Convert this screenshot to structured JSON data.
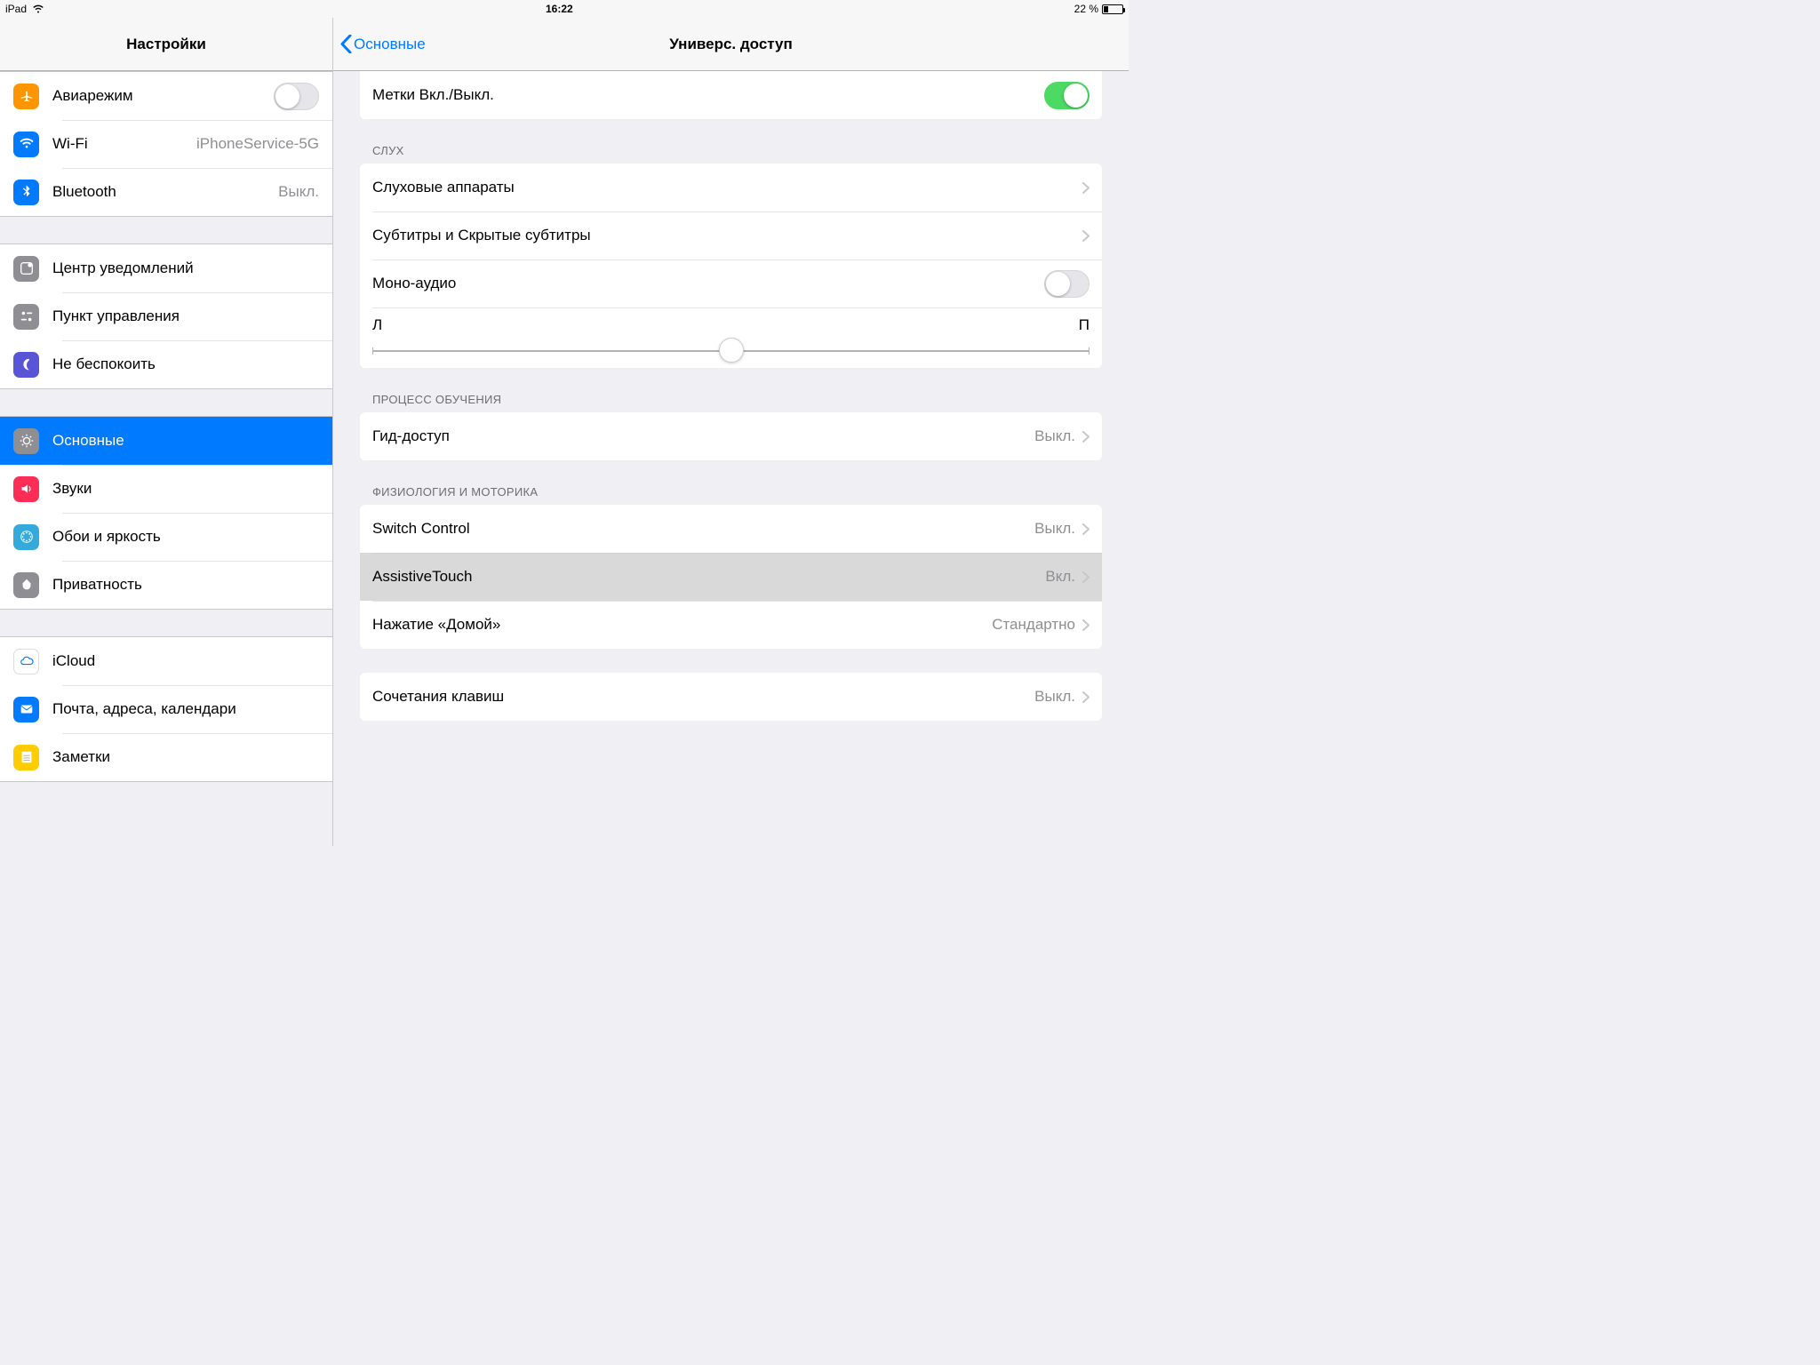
{
  "statusbar": {
    "device": "iPad",
    "time": "16:22",
    "battery_pct": "22 %"
  },
  "sidebar": {
    "title": "Настройки",
    "groups": [
      [
        {
          "id": "airplane",
          "label": "Авиарежим",
          "toggle": false
        },
        {
          "id": "wifi",
          "label": "Wi-Fi",
          "value": "iPhoneService-5G"
        },
        {
          "id": "bluetooth",
          "label": "Bluetooth",
          "value": "Выкл."
        }
      ],
      [
        {
          "id": "notif",
          "label": "Центр уведомлений"
        },
        {
          "id": "control",
          "label": "Пункт управления"
        },
        {
          "id": "dnd",
          "label": "Не беспокоить"
        }
      ],
      [
        {
          "id": "general",
          "label": "Основные",
          "selected": true
        },
        {
          "id": "sounds",
          "label": "Звуки"
        },
        {
          "id": "wallpaper",
          "label": "Обои и яркость"
        },
        {
          "id": "privacy",
          "label": "Приватность"
        }
      ],
      [
        {
          "id": "icloud",
          "label": "iCloud"
        },
        {
          "id": "mail",
          "label": "Почта, адреса, календари"
        },
        {
          "id": "notes",
          "label": "Заметки"
        }
      ]
    ]
  },
  "detail": {
    "back": "Основные",
    "title": "Универс. доступ",
    "top_row": {
      "label": "Метки Вкл./Выкл.",
      "toggle": true
    },
    "sections": [
      {
        "header": "СЛУХ",
        "rows": [
          {
            "kind": "link",
            "label": "Слуховые аппараты"
          },
          {
            "kind": "link",
            "label": "Субтитры и Скрытые субтитры"
          },
          {
            "kind": "toggle",
            "label": "Моно-аудио",
            "on": false
          },
          {
            "kind": "slider",
            "left": "Л",
            "right": "П",
            "pos": 0.5
          }
        ]
      },
      {
        "header": "ПРОЦЕСС ОБУЧЕНИЯ",
        "rows": [
          {
            "kind": "link",
            "label": "Гид-доступ",
            "value": "Выкл."
          }
        ]
      },
      {
        "header": "ФИЗИОЛОГИЯ И МОТОРИКА",
        "rows": [
          {
            "kind": "link",
            "label": "Switch Control",
            "value": "Выкл."
          },
          {
            "kind": "link",
            "label": "AssistiveTouch",
            "value": "Вкл.",
            "highlight": true
          },
          {
            "kind": "link",
            "label": "Нажатие «Домой»",
            "value": "Стандартно"
          }
        ]
      },
      {
        "header": "",
        "rows": [
          {
            "kind": "link",
            "label": "Сочетания клавиш",
            "value": "Выкл."
          }
        ]
      }
    ]
  }
}
